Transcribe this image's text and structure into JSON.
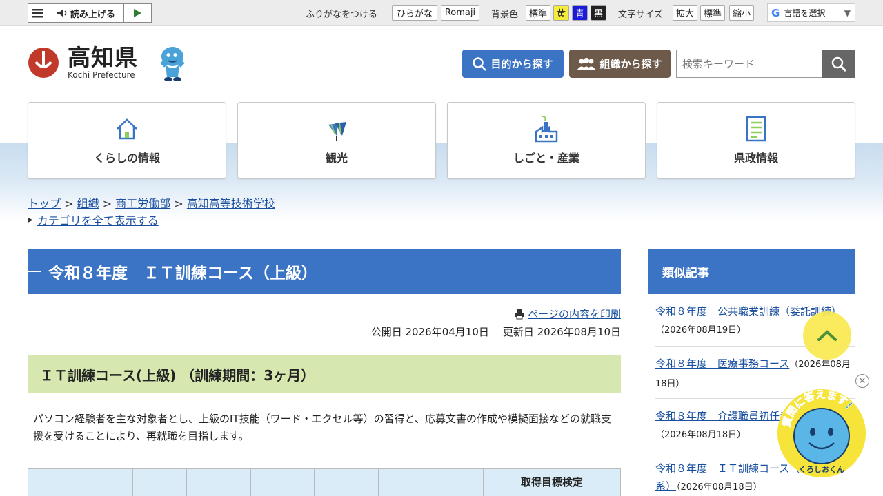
{
  "utilbar": {
    "read_label": "読み上げる",
    "furigana_label": "ふりがなをつける",
    "hiragana": "ひらがな",
    "romaji": "Romaji",
    "bg_label": "背景色",
    "bg_standard": "標準",
    "bg_yellow": "黄",
    "bg_blue": "青",
    "bg_black": "黒",
    "fontsize_label": "文字サイズ",
    "font_enlarge": "拡大",
    "font_standard": "標準",
    "font_reduce": "縮小",
    "translate_label": "言語を選択"
  },
  "header": {
    "logo_jp": "高知県",
    "logo_en": "Kochi Prefecture",
    "purpose_button": "目的から探す",
    "org_button": "組織から探す",
    "search_placeholder": "検索キーワード"
  },
  "nav": [
    {
      "label": "くらしの情報",
      "icon": "house-icon"
    },
    {
      "label": "観光",
      "icon": "tourism-flag-icon"
    },
    {
      "label": "しごと・産業",
      "icon": "factory-icon"
    },
    {
      "label": "県政情報",
      "icon": "document-icon"
    }
  ],
  "breadcrumb": {
    "items": [
      "トップ",
      "組織",
      "商工労働部",
      "高知高等技術学校"
    ],
    "sep": ">",
    "show_all": "カテゴリを全て表示する"
  },
  "article": {
    "title": "令和８年度　ＩＴ訓練コース（上級）",
    "print_label": "ページの内容を印刷",
    "published": "公開日 2026年04月10日",
    "updated": "更新日 2026年08月10日",
    "subheading": "ＩＴ訓練コース(上級) （訓練期間：3ヶ月）",
    "description": "パソコン経験者を主な対象者とし、上級のIT技能（ワード・エクセル等）の習得と、応募文書の作成や模擬面接などの就職支援を受けることにより、再就職を目指します。",
    "table_last_header": "取得目標検定"
  },
  "sidebar": {
    "heading": "類似記事",
    "items": [
      {
        "title": "令和８年度　公共職業訓練（委託訓練）",
        "date": "（2026年08月19日）"
      },
      {
        "title": "令和８年度　医療事務コース",
        "date": "（2026年08月18日）"
      },
      {
        "title": "令和８年度　介護職員初任者研修コース",
        "date": "（2026年08月18日）"
      },
      {
        "title": "令和８年度　ＩＴ訓練コース（デジタル系）",
        "date": "（2026年08月18日）"
      }
    ]
  },
  "chatbot": {
    "banner": "質問に答えます!",
    "name": "くろしおくん"
  },
  "colors": {
    "accent_blue": "#3b74c4",
    "org_brown": "#6d5a4a",
    "subheading_green": "#d6e8b0",
    "logo_red": "#c0392b"
  }
}
